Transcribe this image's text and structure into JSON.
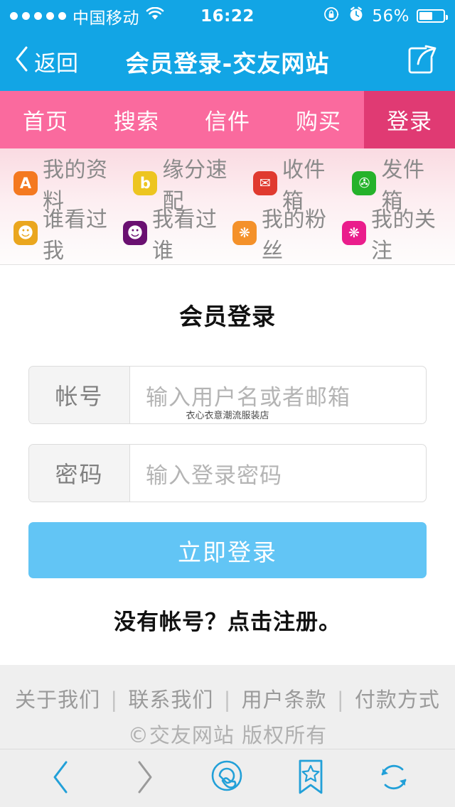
{
  "statusbar": {
    "carrier": "中国移动",
    "time": "16:22",
    "battery_percent": "56%",
    "signal_dots": 5,
    "wifi_icon": "wifi-icon",
    "rotation_lock_icon": "rotation-lock-icon",
    "alarm_icon": "alarm-clock-icon"
  },
  "navbar": {
    "back_label": "返回",
    "title": "会员登录-交友网站",
    "share_icon": "share-icon"
  },
  "tabs": [
    {
      "label": "首页",
      "active": false
    },
    {
      "label": "搜索",
      "active": false
    },
    {
      "label": "信件",
      "active": false
    },
    {
      "label": "购买",
      "active": false
    },
    {
      "label": "登录",
      "active": true
    }
  ],
  "icon_menu": {
    "row1": [
      {
        "label": "我的资料",
        "glyph": "A",
        "color": "#f47920",
        "icon": "profile-icon"
      },
      {
        "label": "缘分速配",
        "glyph": "b",
        "color": "#edc520",
        "icon": "matchmaking-icon"
      },
      {
        "label": "收件箱",
        "glyph": "✉",
        "color": "#e03a2f",
        "icon": "inbox-icon"
      },
      {
        "label": "发件箱",
        "glyph": "✇",
        "color": "#25b22a",
        "icon": "outbox-icon"
      }
    ],
    "row2": [
      {
        "label": "谁看过我",
        "glyph": "☺",
        "color": "#eaa61e",
        "icon": "who-viewed-me-icon"
      },
      {
        "label": "我看过谁",
        "glyph": "☺",
        "color": "#6a1071",
        "icon": "who-i-viewed-icon"
      },
      {
        "label": "我的粉丝",
        "glyph": "❋",
        "color": "#f4912a",
        "icon": "my-fans-icon"
      },
      {
        "label": "我的关注",
        "glyph": "❋",
        "color": "#ea1d8c",
        "icon": "my-follows-icon"
      }
    ]
  },
  "form": {
    "title": "会员登录",
    "account": {
      "label": "帐号",
      "value": "",
      "placeholder": "输入用户名或者邮箱"
    },
    "password": {
      "label": "密码",
      "value": "",
      "placeholder": "输入登录密码"
    },
    "watermark": "衣心衣意潮流服装店",
    "submit_label": "立即登录",
    "register_text": "没有帐号？点击注册。"
  },
  "footer": {
    "links": [
      "关于我们",
      "联系我们",
      "用户条款",
      "付款方式"
    ],
    "separator": "|",
    "copyright": "©交友网站 版权所有"
  },
  "toolbar": {
    "back_icon": "chevron-left-icon",
    "forward_icon": "chevron-right-icon",
    "browser_icon": "qq-browser-icon",
    "bookmark_icon": "bookmark-star-icon",
    "refresh_icon": "refresh-icon"
  },
  "colors": {
    "status_bar": "#12a5e5",
    "nav_bar": "#12a5e5",
    "tab_bar": "#fa6a9e",
    "tab_active": "#e03a73",
    "login_button": "#62c5f5",
    "toolbar_active": "#22a0d8",
    "toolbar_inactive": "#9a9a9a"
  }
}
